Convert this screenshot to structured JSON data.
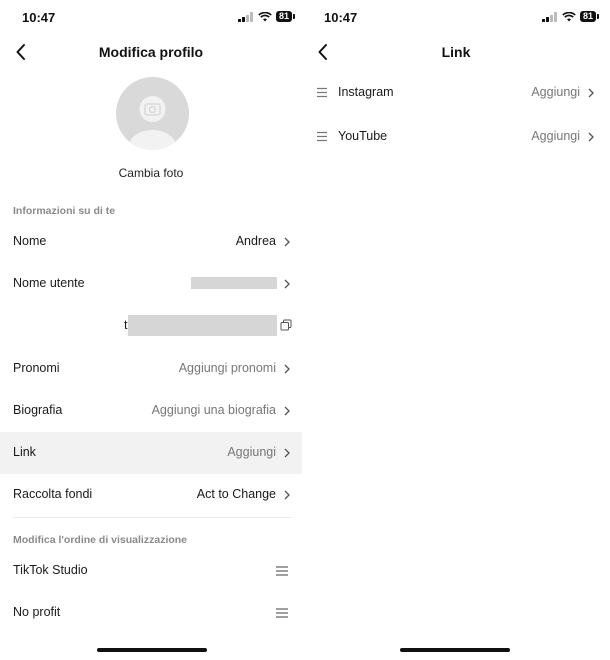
{
  "left": {
    "status": {
      "time": "10:47",
      "battery": "81"
    },
    "nav": {
      "title": "Modifica profilo"
    },
    "change_photo": "Cambia foto",
    "section_about": "Informazioni su di te",
    "rows": {
      "name": {
        "label": "Nome",
        "value": "Andrea"
      },
      "username": {
        "label": "Nome utente"
      },
      "handle": {
        "prefix": "t"
      },
      "pronouns": {
        "label": "Pronomi",
        "value": "Aggiungi pronomi"
      },
      "bio": {
        "label": "Biografia",
        "value": "Aggiungi una biografia"
      },
      "link": {
        "label": "Link",
        "value": "Aggiungi"
      },
      "fundraiser": {
        "label": "Raccolta fondi",
        "value": "Act to Change"
      }
    },
    "section_order": "Modifica l'ordine di visualizzazione",
    "order_items": [
      "TikTok Studio",
      "No profit"
    ]
  },
  "right": {
    "status": {
      "time": "10:47",
      "battery": "81"
    },
    "nav": {
      "title": "Link"
    },
    "links": [
      {
        "label": "Instagram",
        "value": "Aggiungi"
      },
      {
        "label": "YouTube",
        "value": "Aggiungi"
      }
    ]
  }
}
